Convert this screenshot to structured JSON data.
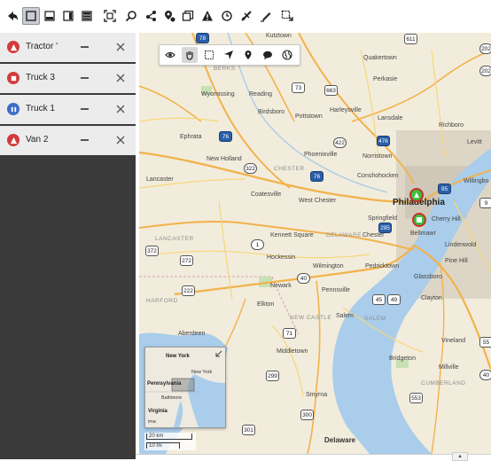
{
  "toolbar": {
    "buttons": [
      "back",
      "select-all",
      "layout-bottom",
      "layout-right",
      "layout-full",
      "fit-to-screen",
      "search",
      "share",
      "geofence",
      "copy",
      "alert",
      "history",
      "route",
      "edit",
      "add"
    ]
  },
  "vehicles": [
    {
      "label": "Tractor '",
      "icon": "truck-icon",
      "color": "#d23b3b"
    },
    {
      "label": "Truck 3",
      "icon": "truck-icon",
      "color": "#d23b3b"
    },
    {
      "label": "Truck 1",
      "icon": "pause-icon",
      "color": "#3e6cc9"
    },
    {
      "label": "Van 2",
      "icon": "truck-icon",
      "color": "#d23b3b"
    }
  ],
  "map": {
    "tools": [
      "eye",
      "pan",
      "box-select",
      "navigate",
      "pin",
      "comment",
      "globe"
    ],
    "active_tool": "pan",
    "places": {
      "kutztown": "Kutztown",
      "quakertown": "Quakertown",
      "perkasie": "Perkasie",
      "wyomissing": "Wyomissing",
      "reading": "Reading",
      "berks": "BERKS",
      "birdsboro": "Birdsboro",
      "pottstown": "Pottstown",
      "harleysville": "Harleysville",
      "lansdale": "Lansdale",
      "richboro": "Richboro",
      "ephrata": "Ephrata",
      "new_holland": "New Holland",
      "phoenixville": "Phoenixville",
      "norristown": "Norristown",
      "levittown": "Levittown",
      "lancaster": "Lancaster",
      "chester": "CHESTER",
      "conshohocken": "Conshohocken",
      "willingboro": "Willingbo",
      "coatesville": "Coatesville",
      "west_chester": "West Chester",
      "philadelphia": "Philadelphia",
      "springfield": "Springfield",
      "cherry_hill": "Cherry Hill",
      "lancaster_county": "LANCASTER",
      "kennett_square": "Kennett Square",
      "delaware_county": "DELAWARE",
      "chester_city": "Chester",
      "bellmawr": "Bellmawr",
      "lindenwold": "Lindenwold",
      "hockessin": "Hockessin",
      "wilmington": "Wilmington",
      "pedricktown": "Pedricktown",
      "pine_hill": "Pine Hill",
      "newark": "Newark",
      "pennsville": "Pennsville",
      "glassboro": "Glassboro",
      "harford": "HARFORD",
      "elkton": "Elkton",
      "new_castle": "NEW CASTLE",
      "salem": "Salem",
      "salem_county": "SALEM",
      "clayton": "Clayton",
      "aberdeen": "Aberdeen",
      "vineland": "Vineland",
      "middletown": "Middletown",
      "bridgeton": "Bridgeton",
      "millville": "Millville",
      "cumberland": "CUMBERLAND",
      "smyrna": "Smyrna",
      "delaware_state": "Delaware",
      "levittown_short": "Levitt"
    },
    "route_shields": [
      "78",
      "73",
      "663",
      "422",
      "476",
      "76",
      "322",
      "76",
      "95",
      "1",
      "372",
      "272",
      "222",
      "40",
      "295",
      "45",
      "49",
      "71",
      "299",
      "553",
      "300",
      "301",
      "9",
      "55",
      "40",
      "202",
      "202",
      "611",
      "222",
      "1"
    ],
    "inset": {
      "labels": [
        "New York",
        "New York",
        "Pennsylvania",
        "Baltimore",
        "Virginia"
      ],
      "extra": "ima"
    },
    "scale": {
      "km": "20 km",
      "mi": "10 mi"
    }
  }
}
